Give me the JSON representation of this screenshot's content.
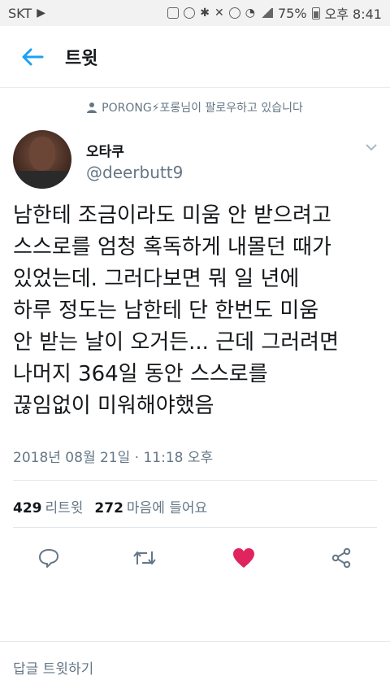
{
  "status_bar": {
    "carrier": "SKT",
    "battery": "75%",
    "time": "오후 8:41"
  },
  "header": {
    "title": "트윗"
  },
  "follow_note": {
    "text": "PORONG⚡포롱님이 팔로우하고 있습니다"
  },
  "tweet": {
    "display_name": "오타쿠",
    "handle": "@deerbutt9",
    "text": "남한테 조금이라도 미움 안 받으려고\n스스로를 엄청 혹독하게 내몰던 때가\n있었는데. 그러다보면 뭐 일 년에\n하루 정도는 남한테 단 한번도 미움\n안 받는 날이 오거든... 근데 그러려면\n나머지 364일 동안 스스로를\n끊임없이 미워해야했음",
    "timestamp": "2018년 08월 21일 · 11:18 오후",
    "retweets": "429",
    "retweets_label": "리트윗",
    "likes": "272",
    "likes_label": "마음에 들어요"
  },
  "reply": {
    "placeholder": "답글 트윗하기"
  },
  "colors": {
    "accent": "#1da1f2",
    "like": "#e0245e",
    "muted": "#657786"
  }
}
